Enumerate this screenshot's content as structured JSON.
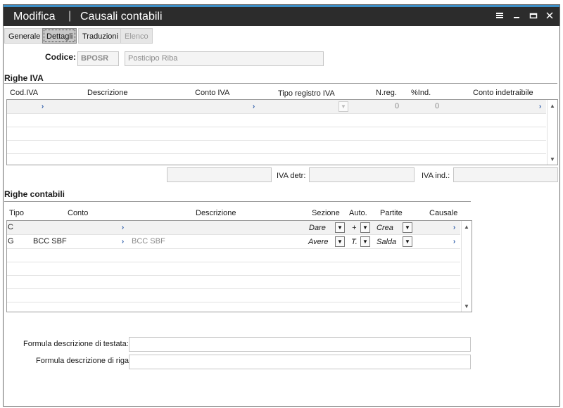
{
  "window": {
    "mode": "Modifica",
    "title": "Causali contabili",
    "icons": [
      "menu-icon",
      "minimize-icon",
      "maximize-icon",
      "close-icon"
    ]
  },
  "tabs": [
    {
      "label": "Generale",
      "state": "normal"
    },
    {
      "label": "Dettagli",
      "state": "active"
    },
    {
      "label": "Traduzioni",
      "state": "normal"
    },
    {
      "label": "Elenco",
      "state": "disabled"
    }
  ],
  "header": {
    "codice_label": "Codice:",
    "codice_value": "BPOSR",
    "descrizione_value": "Posticipo Riba"
  },
  "righe_iva": {
    "section_title": "Righe IVA",
    "columns": [
      "Cod.IVA",
      "Descrizione",
      "Conto IVA",
      "Tipo registro IVA",
      "N.reg.",
      "%Ind.",
      "Conto indetraibile"
    ],
    "row": {
      "nreg": "0",
      "ind": "0"
    },
    "iva_detr_label": "IVA detr:",
    "iva_ind_label": "IVA ind.:"
  },
  "righe_contabili": {
    "section_title": "Righe contabili",
    "columns": [
      "Tipo",
      "Conto",
      "Descrizione",
      "Sezione",
      "Auto.",
      "Partite",
      "Causale"
    ],
    "rows": [
      {
        "tipo": "C",
        "conto": "",
        "descrizione": "",
        "sezione": "Dare",
        "auto": "+",
        "partite": "Crea"
      },
      {
        "tipo": "G",
        "conto": "BCC SBF",
        "descrizione": "BCC SBF",
        "sezione": "Avere",
        "auto": "T.",
        "partite": "Salda"
      }
    ]
  },
  "formula": {
    "testata_label": "Formula descrizione di testata:",
    "riga_label": "Formula descrizione di riga:"
  },
  "colors": {
    "titlebar": "#2c2c2c",
    "accent": "#3c8fc8",
    "zoom_arrow": "#2a5aa8"
  }
}
